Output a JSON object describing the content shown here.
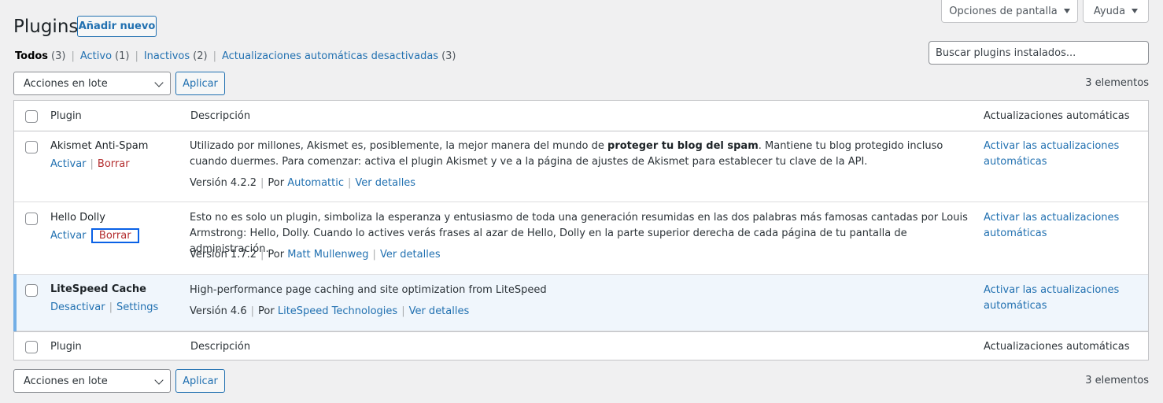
{
  "screen_options": {
    "label": "Opciones de pantalla"
  },
  "help": {
    "label": "Ayuda"
  },
  "page_title": "Plugins",
  "add_new_label": "Añadir nuevo",
  "filters": [
    {
      "label": "Todos",
      "count": "(3)"
    },
    {
      "label": "Activo",
      "count": "(1)"
    },
    {
      "label": "Inactivos",
      "count": "(2)"
    },
    {
      "label": "Actualizaciones automáticas desactivadas",
      "count": "(3)"
    }
  ],
  "search": {
    "placeholder": "Buscar plugins instalados..."
  },
  "bulk": {
    "select_label": "Acciones en lote",
    "apply_label": "Aplicar"
  },
  "items_count": "3 elementos",
  "table": {
    "headers": {
      "plugin": "Plugin",
      "description": "Descripción",
      "auto_updates": "Actualizaciones automáticas"
    },
    "rows": [
      {
        "name": "Akismet Anti-Spam",
        "actions": {
          "primary": "Activar",
          "secondary": "Borrar"
        },
        "description": {
          "before": "Utilizado por millones, Akismet es, posiblemente, la mejor manera del mundo de ",
          "strong": "proteger tu blog del spam",
          "after": ". Mantiene tu blog protegido incluso cuando duermes. Para comenzar: activa el plugin Akismet y ve a la página de ajustes de Akismet para establecer tu clave de la API."
        },
        "version": "Versión 4.2.2",
        "by": "Por",
        "author": "Automattic",
        "details": "Ver detalles",
        "auto_update": "Activar las actualizaciones automáticas"
      },
      {
        "name": "Hello Dolly",
        "actions": {
          "primary": "Activar",
          "secondary": "Borrar"
        },
        "description": {
          "text": "Esto no es solo un plugin, simboliza la esperanza y entusiasmo de toda una generación resumidas en las dos palabras más famosas cantadas por Louis Armstrong: Hello, Dolly. Cuando lo actives verás frases al azar de Hello, Dolly en la parte superior derecha de cada página de tu pantalla de administración."
        },
        "version": "Versión 1.7.2",
        "by": "Por",
        "author": "Matt Mullenweg",
        "details": "Ver detalles",
        "auto_update": "Activar las actualizaciones automáticas"
      },
      {
        "name": "LiteSpeed Cache",
        "actions": {
          "primary": "Desactivar",
          "secondary": "Settings"
        },
        "description": {
          "text": "High-performance page caching and site optimization from LiteSpeed"
        },
        "version": "Versión 4.6",
        "by": "Por",
        "author": "LiteSpeed Technologies",
        "details": "Ver detalles",
        "auto_update": "Activar las actualizaciones automáticas"
      }
    ]
  },
  "colors": {
    "link": "#2271b1",
    "delete": "#b32d2e",
    "active_row_bg": "#f0f6fc",
    "active_border": "#72aee6",
    "focus_outline": "#0a61e6"
  }
}
